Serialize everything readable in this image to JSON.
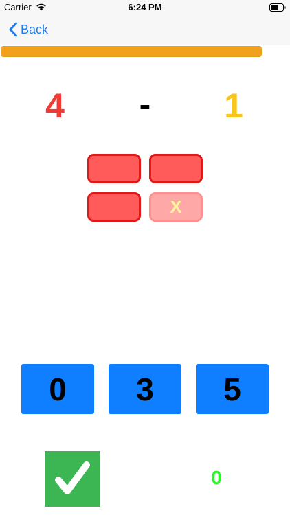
{
  "status_bar": {
    "carrier": "Carrier",
    "time": "6:24 PM",
    "wifi_icon": "wifi-icon",
    "battery_icon": "battery-icon"
  },
  "nav": {
    "back_label": "Back",
    "back_icon": "chevron-left-icon"
  },
  "progress": {
    "fraction": 1.0,
    "color": "#f2a11c"
  },
  "equation": {
    "left": "4",
    "operator": "-",
    "right": "1",
    "left_color": "#f23a34",
    "right_color": "#f7c51c"
  },
  "tiles": [
    {
      "state": "solid",
      "label": ""
    },
    {
      "state": "solid",
      "label": ""
    },
    {
      "state": "solid",
      "label": ""
    },
    {
      "state": "crossed",
      "label": "X"
    }
  ],
  "answers": [
    "0",
    "3",
    "5"
  ],
  "answer_color": "#0f7fff",
  "check_button": {
    "icon": "checkmark-icon",
    "color": "#3cb553"
  },
  "score": "0"
}
